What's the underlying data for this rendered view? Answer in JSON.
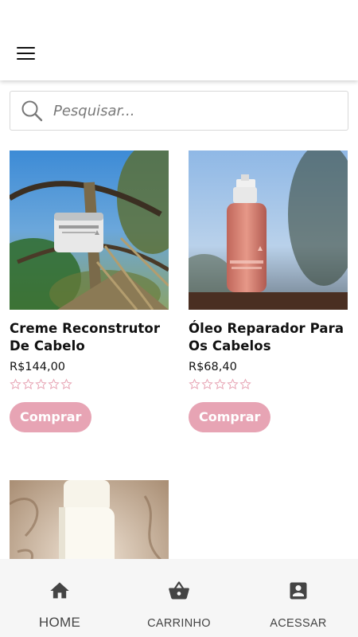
{
  "search": {
    "placeholder": "Pesquisar..."
  },
  "products": [
    {
      "title": "Creme Reconstrutor De Cabelo",
      "price": "R$144,00",
      "rating": 0,
      "button": "Comprar"
    },
    {
      "title": "Óleo Reparador Para Os Cabelos",
      "price": "R$68,40",
      "rating": 0,
      "button": "Comprar"
    },
    {
      "title": "",
      "price": "",
      "rating": 0,
      "button": ""
    }
  ],
  "bottom_nav": {
    "home": "HOME",
    "cart": "CARRINHO",
    "account": "ACESSAR"
  },
  "colors": {
    "accent": "#e7a4b4",
    "star_outline": "#e7a4b4",
    "nav_bg": "#f6f6f6",
    "nav_icon": "#444444"
  }
}
